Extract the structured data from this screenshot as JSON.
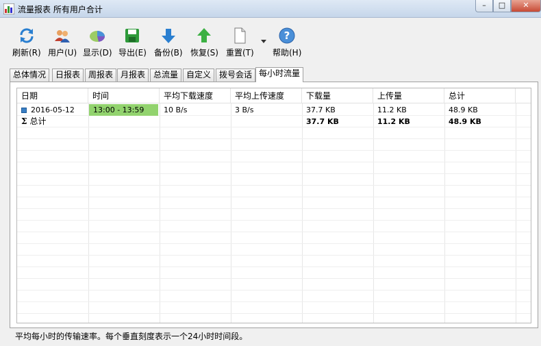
{
  "window": {
    "title": "流量报表 所有用户合计",
    "minimize": "–",
    "maximize": "□",
    "close": "✕"
  },
  "toolbar": [
    {
      "label": "刷新(R)",
      "icon": "refresh-icon"
    },
    {
      "label": "用户(U)",
      "icon": "users-icon"
    },
    {
      "label": "显示(D)",
      "icon": "display-icon"
    },
    {
      "label": "导出(E)",
      "icon": "save-icon"
    },
    {
      "label": "备份(B)",
      "icon": "backup-arrow-down-icon"
    },
    {
      "label": "恢复(S)",
      "icon": "restore-arrow-up-icon"
    },
    {
      "label": "重置(T)",
      "icon": "reset-document-icon"
    },
    {
      "label": "帮助(H)",
      "icon": "help-icon"
    }
  ],
  "tabs": [
    "总体情况",
    "日报表",
    "周报表",
    "月报表",
    "总流量",
    "自定义",
    "拨号会话",
    "每小时流量"
  ],
  "active_tab": "每小时流量",
  "table": {
    "columns": [
      "日期",
      "时间",
      "平均下载速度",
      "平均上传速度",
      "下载量",
      "上传量",
      "总计"
    ],
    "rows": [
      {
        "date": "2016-05-12",
        "time": "13:00 - 13:59",
        "avg_down": "10 B/s",
        "avg_up": "3 B/s",
        "download": "37.7 KB",
        "upload": "11.2 KB",
        "total": "48.9 KB"
      }
    ],
    "summary": {
      "label": "总计",
      "download": "37.7 KB",
      "upload": "11.2 KB",
      "total": "48.9 KB"
    }
  },
  "status_text": "平均每小时的传输速率。每个垂直刻度表示一个24小时时间段。",
  "colors": {
    "highlight": "#92d36e",
    "row_icon": "#3a7fc4"
  }
}
